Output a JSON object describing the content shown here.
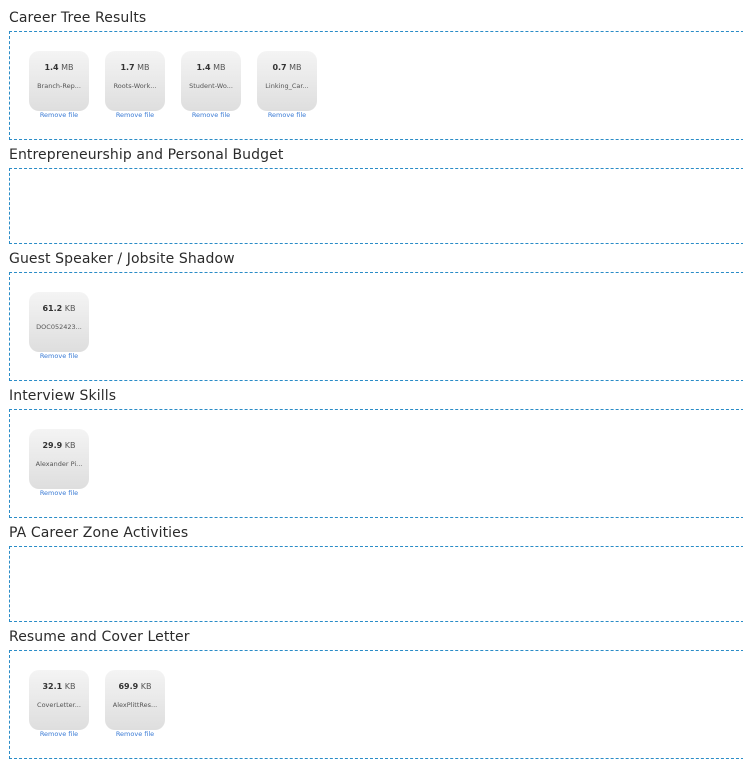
{
  "sections": [
    {
      "title": "Career Tree Results",
      "files": [
        {
          "size": "1.4",
          "unit": "MB",
          "name": "Branch-Rep...",
          "remove_label": "Remove file"
        },
        {
          "size": "1.7",
          "unit": "MB",
          "name": "Roots-Work...",
          "remove_label": "Remove file"
        },
        {
          "size": "1.4",
          "unit": "MB",
          "name": "Student-Wo...",
          "remove_label": "Remove file"
        },
        {
          "size": "0.7",
          "unit": "MB",
          "name": "Linking_Car...",
          "remove_label": "Remove file"
        }
      ]
    },
    {
      "title": "Entrepreneurship and Personal Budget",
      "files": []
    },
    {
      "title": "Guest Speaker / Jobsite Shadow",
      "files": [
        {
          "size": "61.2",
          "unit": "KB",
          "name": "DOC052423...",
          "remove_label": "Remove file"
        }
      ]
    },
    {
      "title": "Interview Skills",
      "files": [
        {
          "size": "29.9",
          "unit": "KB",
          "name": "Alexander Pi...",
          "remove_label": "Remove file"
        }
      ]
    },
    {
      "title": "PA Career Zone Activities",
      "files": []
    },
    {
      "title": "Resume and Cover Letter",
      "files": [
        {
          "size": "32.1",
          "unit": "KB",
          "name": "CoverLetter...",
          "remove_label": "Remove file"
        },
        {
          "size": "69.9",
          "unit": "KB",
          "name": "AlexPlittRes...",
          "remove_label": "Remove file"
        }
      ]
    }
  ]
}
